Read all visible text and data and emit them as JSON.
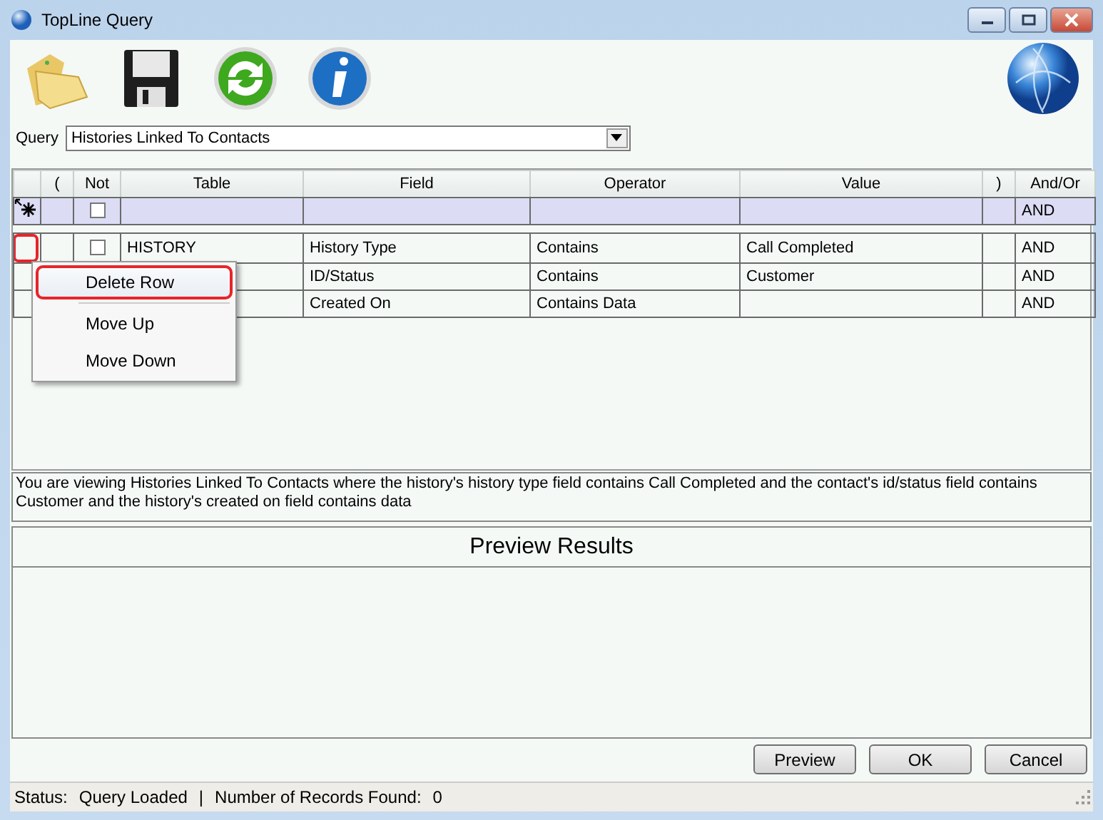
{
  "window": {
    "title": "TopLine Query"
  },
  "toolbar": [
    {
      "kind": "folder"
    },
    {
      "kind": "save"
    },
    {
      "kind": "refresh"
    },
    {
      "kind": "info"
    }
  ],
  "query": {
    "label": "Query",
    "value": "Histories Linked To Contacts"
  },
  "grid": {
    "columns": [
      "(",
      "Not",
      "Table",
      "Field",
      "Operator",
      "Value",
      ")",
      "And/Or"
    ],
    "new_row": {
      "not_checked": false,
      "and_or": "AND"
    },
    "rows": [
      {
        "marked": true,
        "not_checked": false,
        "table": "HISTORY",
        "field": "History Type",
        "operator": "Contains",
        "value": "Call Completed",
        "and_or": "AND"
      },
      {
        "marked": false,
        "field": "ID/Status",
        "operator": "Contains",
        "value": "Customer",
        "and_or": "AND"
      },
      {
        "marked": false,
        "field": "Created On",
        "operator": "Contains Data",
        "and_or": "AND"
      }
    ]
  },
  "context_menu": [
    {
      "label": "Delete Row",
      "selected": true
    },
    {
      "label": "Move Up",
      "selected": false
    },
    {
      "label": "Move Down",
      "selected": false
    }
  ],
  "description": "You are viewing Histories Linked To Contacts where the history's history type field contains Call Completed and the contact's id/status field contains Customer and the history's created on field contains data",
  "preview": {
    "title": "Preview Results"
  },
  "buttons": [
    "Preview",
    "OK",
    "Cancel"
  ],
  "status_bar": {
    "status_label": "Status:",
    "status": "Query Loaded",
    "separator": "|",
    "count_label": "Number of Records Found:",
    "count": "0"
  }
}
